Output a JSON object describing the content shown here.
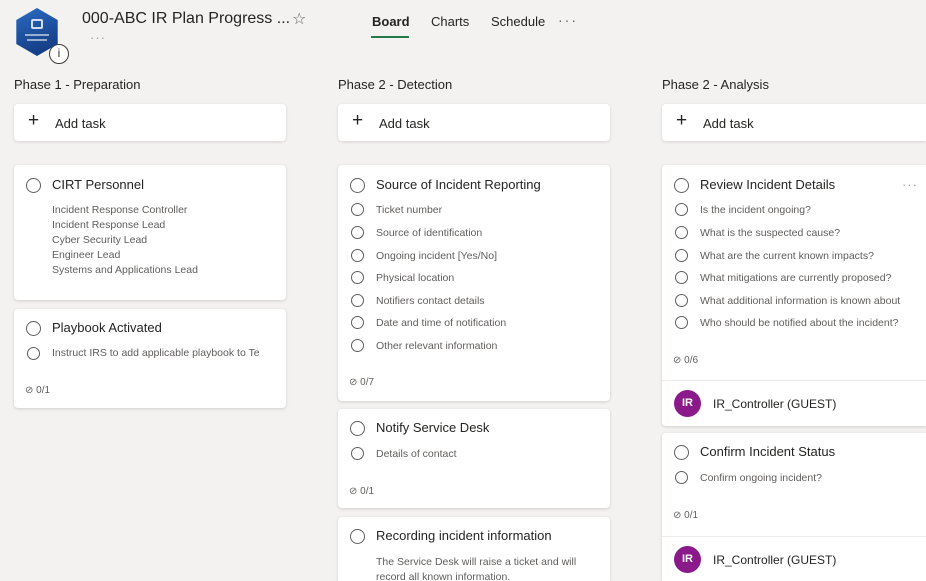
{
  "header": {
    "plan_title": "000-ABC IR Plan Progress ...",
    "info_label": "i",
    "more_label": "···",
    "tabs": [
      {
        "label": "Board",
        "active": true
      },
      {
        "label": "Charts",
        "active": false
      },
      {
        "label": "Schedule",
        "active": false
      }
    ],
    "tabs_more": "···"
  },
  "colors": {
    "accent": "#237b4b",
    "avatar": "#8a1a8a",
    "logo": "#1a4a96",
    "background": "#f3f2f1"
  },
  "add_task_label": "Add task",
  "buckets": [
    {
      "title": "Phase 1 - Preparation",
      "cards": [
        {
          "title": "CIRT Personnel",
          "description": [
            "Incident Response Controller",
            "Incident Response Lead",
            "Cyber Security Lead",
            "Engineer Lead",
            "Systems and Applications Lead"
          ]
        },
        {
          "title": "Playbook Activated",
          "items": [
            "Instruct IRS to add applicable playbook to Te"
          ],
          "progress": "0/1"
        }
      ]
    },
    {
      "title": "Phase 2 - Detection",
      "cards": [
        {
          "title": "Source of Incident Reporting",
          "items": [
            "Ticket number",
            "Source of identification",
            "Ongoing incident [Yes/No]",
            "Physical location",
            "Notifiers contact details",
            "Date and time of notification",
            "Other relevant information"
          ],
          "progress": "0/7"
        },
        {
          "title": "Notify Service Desk",
          "items": [
            "Details of contact"
          ],
          "progress": "0/1"
        },
        {
          "title": "Recording incident information",
          "description": [
            "The Service Desk will raise a ticket and will",
            "record all known information."
          ]
        }
      ]
    },
    {
      "title": "Phase 2 - Analysis",
      "cards": [
        {
          "title": "Review Incident Details",
          "more": "···",
          "items": [
            "Is the incident ongoing?",
            "What is the suspected cause?",
            "What are the current known impacts?",
            "What mitigations are currently proposed?",
            "What additional information is known about",
            "Who should be notified about the incident?"
          ],
          "progress": "0/6",
          "assignee": {
            "initials": "IR",
            "name": "IR_Controller (GUEST)"
          }
        },
        {
          "title": "Confirm Incident Status",
          "items": [
            "Confirm ongoing incident?"
          ],
          "progress": "0/1",
          "assignee": {
            "initials": "IR",
            "name": "IR_Controller (GUEST)"
          }
        }
      ]
    }
  ]
}
